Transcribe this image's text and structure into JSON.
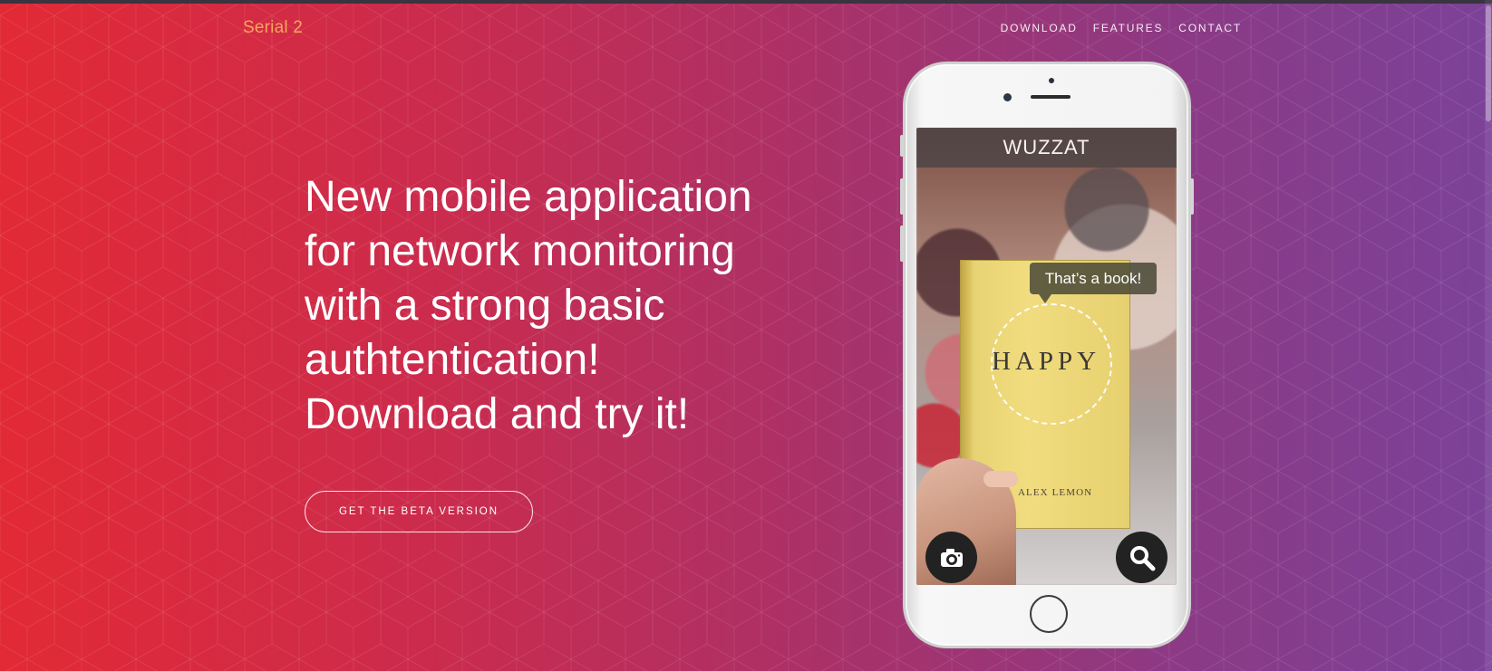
{
  "brand": "Serial 2",
  "nav": {
    "download": "DOWNLOAD",
    "features": "FEATURES",
    "contact": "CONTACT"
  },
  "hero": {
    "headline_lines": [
      "New mobile application",
      "for network monitoring",
      "with a strong basic",
      "authtentication!",
      "Download and try it!"
    ],
    "cta": "GET THE BETA VERSION"
  },
  "phone_screen": {
    "app_title": "WUZZAT",
    "bubble": "That’s a book!",
    "book_title": "HAPPY",
    "book_author": "ALEX LEMON"
  },
  "icons": {
    "camera": "camera-icon",
    "search": "search-icon"
  },
  "colors": {
    "brand": "#f2a65a",
    "gradient_start": "#e22a35",
    "gradient_end": "#7b4298"
  }
}
